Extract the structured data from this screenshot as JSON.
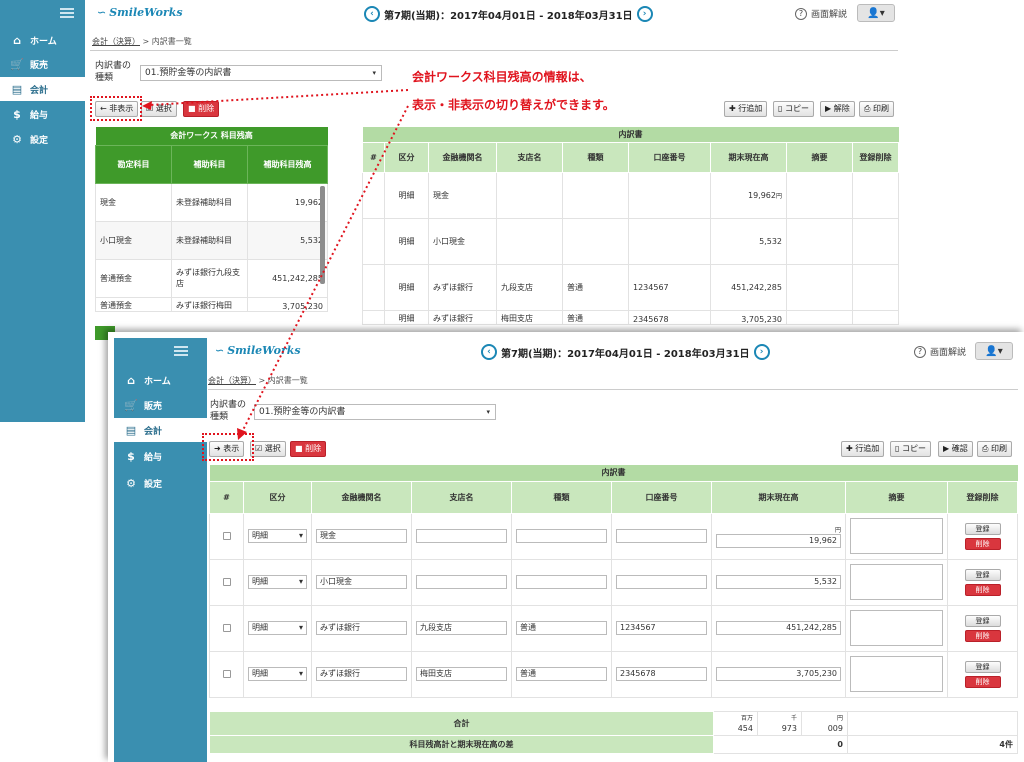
{
  "app": {
    "logo": "SmileWorks",
    "period": "第7期(当期)：2017年04月01日 - 2018年03月31日",
    "help_label": "画面解説",
    "user_icon": "user-icon"
  },
  "sidebar": {
    "items": [
      {
        "label": "ホーム",
        "icon": "home-icon"
      },
      {
        "label": "販売",
        "icon": "cart-icon"
      },
      {
        "label": "会計",
        "icon": "calculator-icon"
      },
      {
        "label": "給与",
        "icon": "money-bag-icon"
      },
      {
        "label": "設定",
        "icon": "gear-icon"
      }
    ]
  },
  "breadcrumb": {
    "link": "会計（決算）",
    "separator": ">",
    "current": "内訳書一覧"
  },
  "form": {
    "kind_label": "内訳書の種類",
    "kind_value": "01.預貯金等の内訳書"
  },
  "toolbar_top": {
    "toggle": "非表示",
    "select": "選択",
    "delete": "削除",
    "add_row": "行追加",
    "copy": "コピー",
    "release": "解除",
    "print": "印刷"
  },
  "toolbar_bottom": {
    "toggle": "表示",
    "select": "選択",
    "delete": "削除",
    "add_row": "行追加",
    "copy": "コピー",
    "confirm": "確認",
    "print": "印刷"
  },
  "annotation": {
    "line1": "会計ワークス科目残高の情報は、",
    "line2": "表示・非表示の切り替えができます。"
  },
  "balance_table": {
    "title": "会計ワークス 科目残高",
    "headers": [
      "勘定科目",
      "補助科目",
      "補助科目残高"
    ],
    "rows": [
      {
        "account": "現金",
        "sub": "未登録補助科目",
        "amount": "19,962"
      },
      {
        "account": "小口現金",
        "sub": "未登録補助科目",
        "amount": "5,532"
      },
      {
        "account": "普通預金",
        "sub": "みずほ銀行九段支店",
        "amount": "451,242,285"
      },
      {
        "account": "普通預金",
        "sub": "みずほ銀行梅田",
        "amount": "3,705,230"
      }
    ]
  },
  "detail": {
    "title": "内訳書",
    "headers": [
      "#",
      "区分",
      "金融機関名",
      "支店名",
      "種類",
      "口座番号",
      "期末現在高",
      "摘要",
      "登録削除"
    ],
    "yen_unit": "円",
    "register_label": "登録",
    "delete_label": "削除",
    "rows": [
      {
        "kubun": "明細",
        "bank": "現金",
        "branch": "",
        "type": "",
        "account_no": "",
        "amount": "19,962"
      },
      {
        "kubun": "明細",
        "bank": "小口現金",
        "branch": "",
        "type": "",
        "account_no": "",
        "amount": "5,532"
      },
      {
        "kubun": "明細",
        "bank": "みずほ銀行",
        "branch": "九段支店",
        "type": "普通",
        "account_no": "1234567",
        "amount": "451,242,285"
      },
      {
        "kubun": "明細",
        "bank": "みずほ銀行",
        "branch": "梅田支店",
        "type": "普通",
        "account_no": "2345678",
        "amount": "3,705,230"
      }
    ]
  },
  "summary": {
    "total_label": "合計",
    "unit_labels": [
      "百万",
      "千",
      "円"
    ],
    "unit_values": [
      "454",
      "973",
      "009"
    ],
    "diff_label": "科目残高計と期末現在高の差",
    "diff_value": "0",
    "count": "4件"
  },
  "colors": {
    "sidebar": "#3a8fb0",
    "accent": "#1b87b5",
    "green": "#3f9a2a",
    "light_green": "#c9e7bd",
    "red": "#d9363e",
    "annotation": "#e0141e"
  }
}
